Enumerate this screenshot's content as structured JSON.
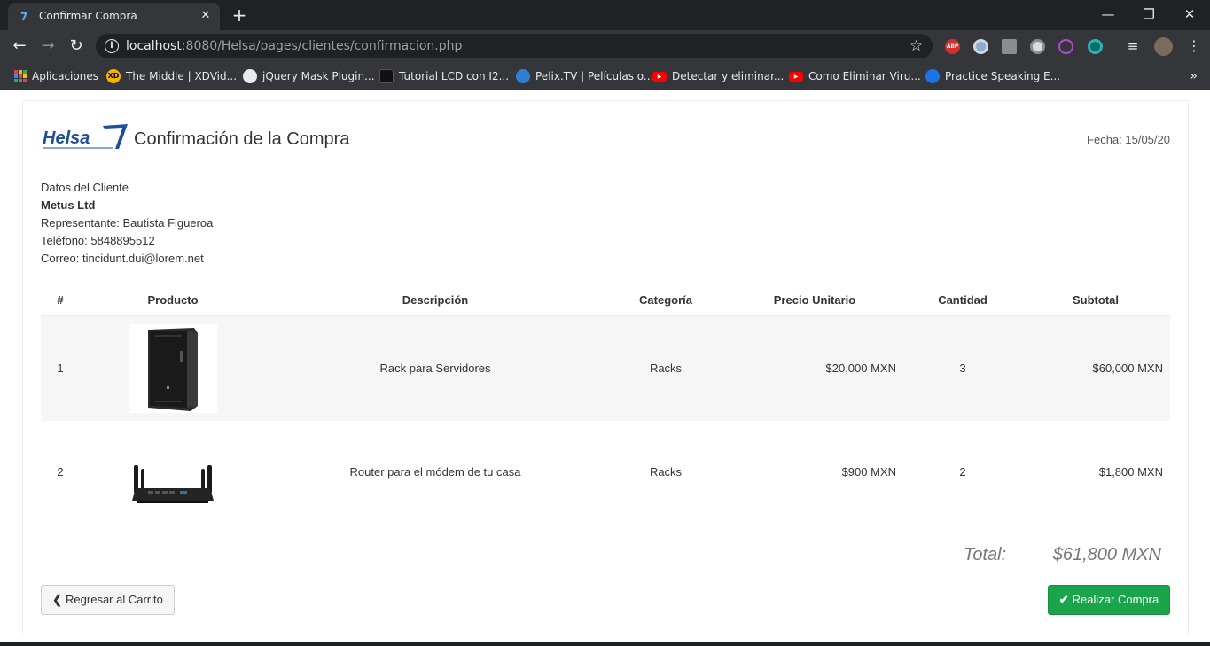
{
  "browser": {
    "tab_title": "Confirmar Compra",
    "tab_close": "✕",
    "new_tab": "+",
    "url_host": "localhost",
    "url_rest": ":8080/Helsa/pages/clientes/confirmacion.php",
    "window_controls": {
      "minimize": "—",
      "restore": "❐",
      "close": "✕"
    },
    "bookmarks": [
      {
        "label": "Aplicaciones",
        "icon": "apps-grid-icon"
      },
      {
        "label": "The Middle | XDVid...",
        "icon": "xd-icon",
        "color": "#f6b400"
      },
      {
        "label": "jQuery Mask Plugin...",
        "icon": "github-icon",
        "color": "#e8eaed"
      },
      {
        "label": "Tutorial LCD con I2...",
        "icon": "bird-icon",
        "color": "#111111"
      },
      {
        "label": "Pelix.TV | Películas o...",
        "icon": "pelix-icon",
        "color": "#2f7fd9"
      },
      {
        "label": "Detectar y eliminar...",
        "icon": "youtube-icon",
        "color": "#ff0000"
      },
      {
        "label": "Como Eliminar Viru...",
        "icon": "youtube-icon",
        "color": "#ff0000"
      },
      {
        "label": "Practice Speaking E...",
        "icon": "globe-icon",
        "color": "#1a73e8"
      }
    ],
    "overflow": "»",
    "extension_abp": "ABP"
  },
  "page": {
    "title": "Confirmación de la Compra",
    "date": "Fecha: 15/05/20",
    "client": {
      "heading": "Datos del Cliente",
      "name": "Metus Ltd",
      "representative": "Representante: Bautista Figueroa",
      "phone": "Teléfono: 5848895512",
      "email": "Correo: tincidunt.dui@lorem.net"
    },
    "table": {
      "headers": [
        "#",
        "Producto",
        "Descripción",
        "Categoría",
        "Precio Unitario",
        "Cantidad",
        "Subtotal"
      ],
      "rows": [
        {
          "num": "1",
          "image": "server-rack-image",
          "description": "Rack para Servidores",
          "category": "Racks",
          "unit_price": "$20,000 MXN",
          "quantity": "3",
          "subtotal": "$60,000 MXN"
        },
        {
          "num": "2",
          "image": "router-image",
          "description": "Router para el módem de tu casa",
          "category": "Racks",
          "unit_price": "$900 MXN",
          "quantity": "2",
          "subtotal": "$1,800 MXN"
        }
      ]
    },
    "total_label": "Total:",
    "total_value": "$61,800 MXN",
    "back_button": "Regresar al Carrito",
    "buy_button": "Realizar Compra",
    "logo_text": "Helsa"
  },
  "colors": {
    "accent_green": "#1aa54a",
    "logo_blue": "#1f4e9a",
    "row_stripe": "#f6f6f6"
  }
}
